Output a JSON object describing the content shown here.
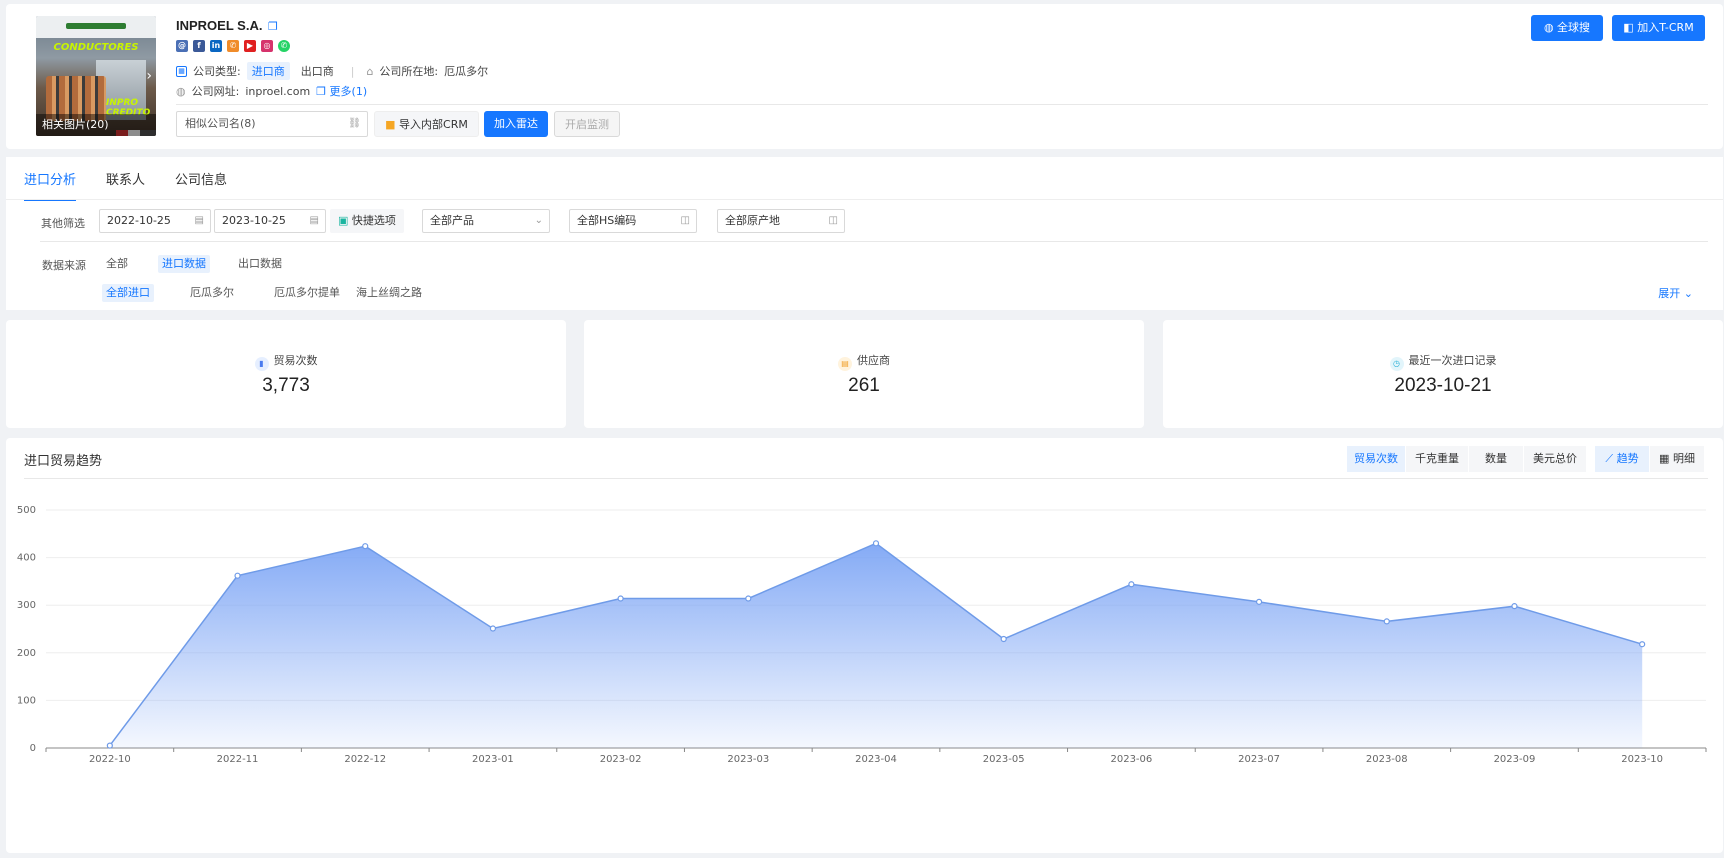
{
  "company": {
    "name": "INPROEL S.A.",
    "thumb_banner": "CONDUCTORES",
    "thumb_promo": "INPRO CREDITO",
    "photos_label": "相关图片(20)",
    "type_label": "公司类型:",
    "types": [
      "进口商",
      "出口商"
    ],
    "location_label": "公司所在地:",
    "location": "厄瓜多尔",
    "site_label": "公司网址:",
    "site": "inproel.com",
    "more": "更多(1)"
  },
  "actions": {
    "similar": "相似公司名(8)",
    "import_crm": "导入内部CRM",
    "add_radar": "加入雷达",
    "monitor": "开启监测",
    "global_search": "全球搜",
    "add_tcrm": "加入T-CRM"
  },
  "tabs": [
    "进口分析",
    "联系人",
    "公司信息"
  ],
  "filters": {
    "label": "其他筛选",
    "date_from": "2022-10-25",
    "date_to": "2023-10-25",
    "quick": "快捷选项",
    "product": "全部产品",
    "hs": "全部HS编码",
    "origin": "全部原产地",
    "source_label": "数据来源",
    "sources": [
      "全部",
      "进口数据",
      "出口数据"
    ],
    "sub_sources": [
      "全部进口",
      "厄瓜多尔",
      "厄瓜多尔提单",
      "海上丝绸之路"
    ],
    "expand": "展开"
  },
  "stats": {
    "trades_label": "贸易次数",
    "trades_value": "3,773",
    "suppliers_label": "供应商",
    "suppliers_value": "261",
    "last_label": "最近一次进口记录",
    "last_value": "2023-10-21"
  },
  "chart": {
    "title": "进口贸易趋势",
    "metrics": [
      "贸易次数",
      "千克重量",
      "数量",
      "美元总价"
    ],
    "views": [
      "趋势",
      "明细"
    ]
  },
  "colors": {
    "accent": "#1677ff",
    "line": "#6f9be8",
    "fill_top": "#7ea6f5"
  },
  "chart_data": {
    "type": "area",
    "categories": [
      "2022-10",
      "2022-11",
      "2022-12",
      "2023-01",
      "2023-02",
      "2023-03",
      "2023-04",
      "2023-05",
      "2023-06",
      "2023-07",
      "2023-08",
      "2023-09",
      "2023-10"
    ],
    "values": [
      5,
      362,
      424,
      251,
      314,
      314,
      430,
      229,
      344,
      307,
      266,
      298,
      218
    ],
    "yticks": [
      0,
      100,
      200,
      300,
      400,
      500
    ],
    "ylim": [
      0,
      500
    ],
    "grid": true
  }
}
